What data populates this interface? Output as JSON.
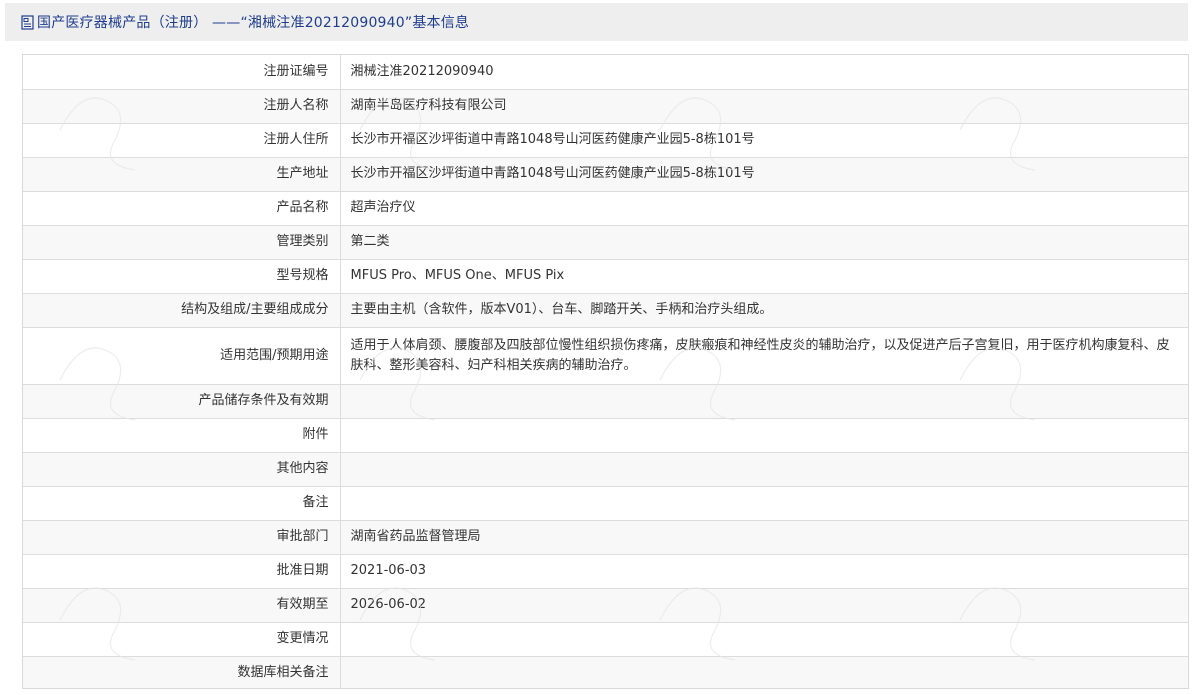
{
  "header": {
    "title": "国产医疗器械产品（注册） ——“湘械注准20212090940”基本信息",
    "icon": "document-icon"
  },
  "rows": [
    {
      "label": "注册证编号",
      "value": "湘械注准20212090940"
    },
    {
      "label": "注册人名称",
      "value": "湖南半岛医疗科技有限公司"
    },
    {
      "label": "注册人住所",
      "value": "长沙市开福区沙坪街道中青路1048号山河医药健康产业园5-8栋101号"
    },
    {
      "label": "生产地址",
      "value": "长沙市开福区沙坪街道中青路1048号山河医药健康产业园5-8栋101号"
    },
    {
      "label": "产品名称",
      "value": "超声治疗仪"
    },
    {
      "label": "管理类别",
      "value": "第二类"
    },
    {
      "label": "型号规格",
      "value": "MFUS Pro、MFUS One、MFUS Pix"
    },
    {
      "label": "结构及组成/主要组成成分",
      "value": "主要由主机（含软件，版本V01）、台车、脚踏开关、手柄和治疗头组成。"
    },
    {
      "label": "适用范围/预期用途",
      "value": "适用于人体肩颈、腰腹部及四肢部位慢性组织损伤疼痛，皮肤瘢痕和神经性皮炎的辅助治疗，以及促进产后子宫复旧，用于医疗机构康复科、皮肤科、整形美容科、妇产科相关疾病的辅助治疗。"
    },
    {
      "label": "产品储存条件及有效期",
      "value": ""
    },
    {
      "label": "附件",
      "value": ""
    },
    {
      "label": "其他内容",
      "value": ""
    },
    {
      "label": "备注",
      "value": ""
    },
    {
      "label": "审批部门",
      "value": "湖南省药品监督管理局"
    },
    {
      "label": "批准日期",
      "value": "2021-06-03"
    },
    {
      "label": "有效期至",
      "value": "2026-06-02"
    },
    {
      "label": "变更情况",
      "value": ""
    },
    {
      "label": "数据库相关备注",
      "value": ""
    }
  ],
  "colors": {
    "header_bg": "#eeeeee",
    "header_text": "#1f3d8f",
    "border": "#dcdcdc",
    "text": "#333333"
  }
}
